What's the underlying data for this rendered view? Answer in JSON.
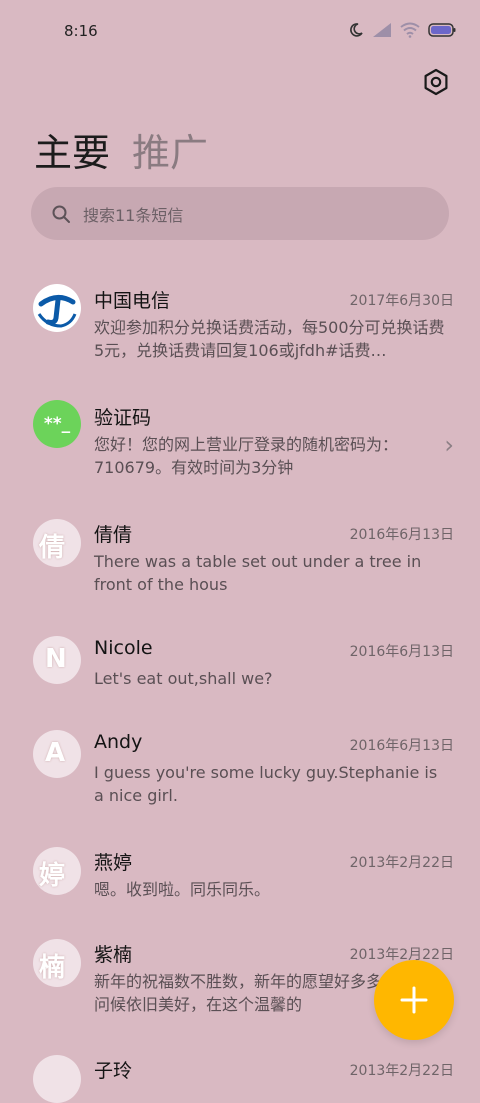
{
  "status": {
    "time": "8:16"
  },
  "tabs": {
    "primary": "主要",
    "promotions": "推广"
  },
  "search": {
    "placeholder": "搜索11条短信"
  },
  "conversations": [
    {
      "name": "中国电信",
      "date": "2017年6月30日",
      "preview": "欢迎参加积分兑换话费活动，每500分可兑换话费5元，兑换话费请回复106或jfdh#话费…"
    },
    {
      "name": "验证码",
      "date": "",
      "avatar_text": "**_",
      "preview": "您好！您的网上营业厅登录的随机密码为：710679。有效时间为3分钟"
    },
    {
      "name": "倩倩",
      "date": "2016年6月13日",
      "avatar_text": "倩",
      "preview": "There was a table set out under a tree in front of the hous"
    },
    {
      "name": "Nicole",
      "date": "2016年6月13日",
      "avatar_text": "N",
      "preview": "Let's eat out,shall we?"
    },
    {
      "name": "Andy",
      "date": "2016年6月13日",
      "avatar_text": "A",
      "preview": "I guess you're some lucky guy.Stephanie is a nice girl."
    },
    {
      "name": "燕婷",
      "date": "2013年2月22日",
      "avatar_text": "婷",
      "preview": "嗯。收到啦。同乐同乐。"
    },
    {
      "name": "紫楠",
      "date": "2013年2月22日",
      "avatar_text": "楠",
      "preview": "新年的祝福数不胜数，新年的愿望好多多，新年的问候依旧美好，在这个温馨的"
    },
    {
      "name": "子玲",
      "date": "2013年2月22日",
      "avatar_text": ""
    }
  ],
  "colors": {
    "background": "#d9b9c2",
    "fab": "#ffb700",
    "telecom_blue": "#0b5aa8",
    "code_green": "#6cd35a"
  },
  "icons": {
    "settings": "settings-icon",
    "search": "search-icon",
    "compose": "plus-icon",
    "chevron": "chevron-right-icon"
  }
}
